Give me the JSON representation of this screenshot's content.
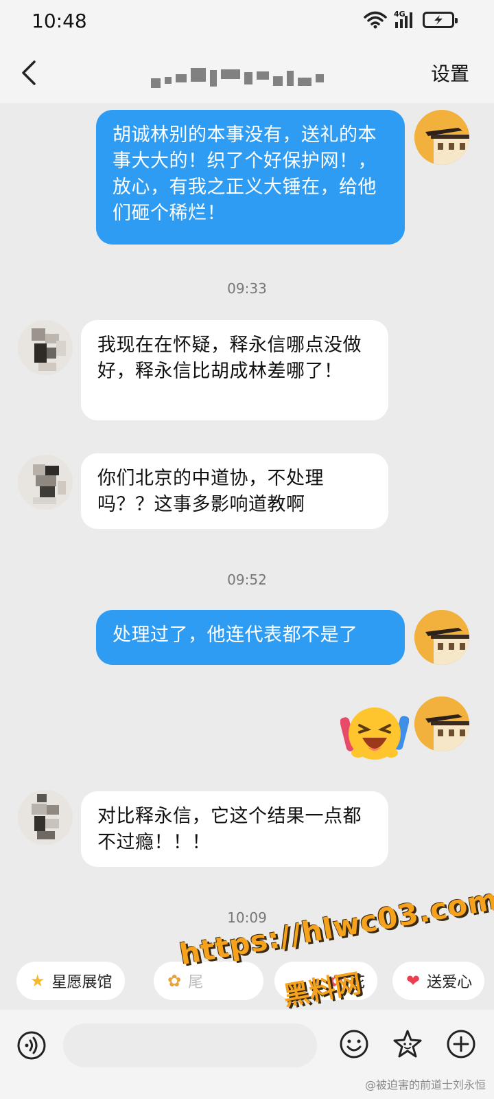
{
  "status_bar": {
    "time": "10:48",
    "network": "4G"
  },
  "header": {
    "title": "█████",
    "settings_label": "设置"
  },
  "messages": [
    {
      "side": "self",
      "text": "胡诚林别的本事没有，送礼的本事大大的！织了个好保护网！，放心，有我之正义大锤在，给他们砸个稀烂！"
    },
    {
      "type": "time",
      "text": "09:33"
    },
    {
      "side": "other",
      "text": "我现在在怀疑，释永信哪点没做好，释永信比胡成林差哪了！"
    },
    {
      "side": "other",
      "text": "你们北京的中道协，不处理吗？？这事多影响道教啊"
    },
    {
      "type": "time",
      "text": "09:52"
    },
    {
      "side": "self",
      "text": "处理过了，他连代表都不是了"
    },
    {
      "side": "self",
      "type": "sticker",
      "icon": "laughing-cheering-emoji"
    },
    {
      "side": "other",
      "text": "对比释永信，它这个结果一点都不过瘾！！！"
    },
    {
      "type": "time",
      "text": "10:09"
    }
  ],
  "chips": [
    {
      "icon": "star-icon",
      "label": "星愿展馆"
    },
    {
      "icon": "flower-icon",
      "label": "尾"
    },
    {
      "icon": "flower-icon",
      "label": "花"
    },
    {
      "icon": "heart-icon",
      "label": "送爱心"
    }
  ],
  "watermark": {
    "url": "https://hlwc03.com",
    "brand": "黑料网",
    "credit": "@被迫害的前道士刘永恒"
  },
  "colors": {
    "self_bubble": "#2f9cf3",
    "other_bubble": "#ffffff",
    "background": "#ebebeb",
    "watermark": "#f6a21c"
  }
}
